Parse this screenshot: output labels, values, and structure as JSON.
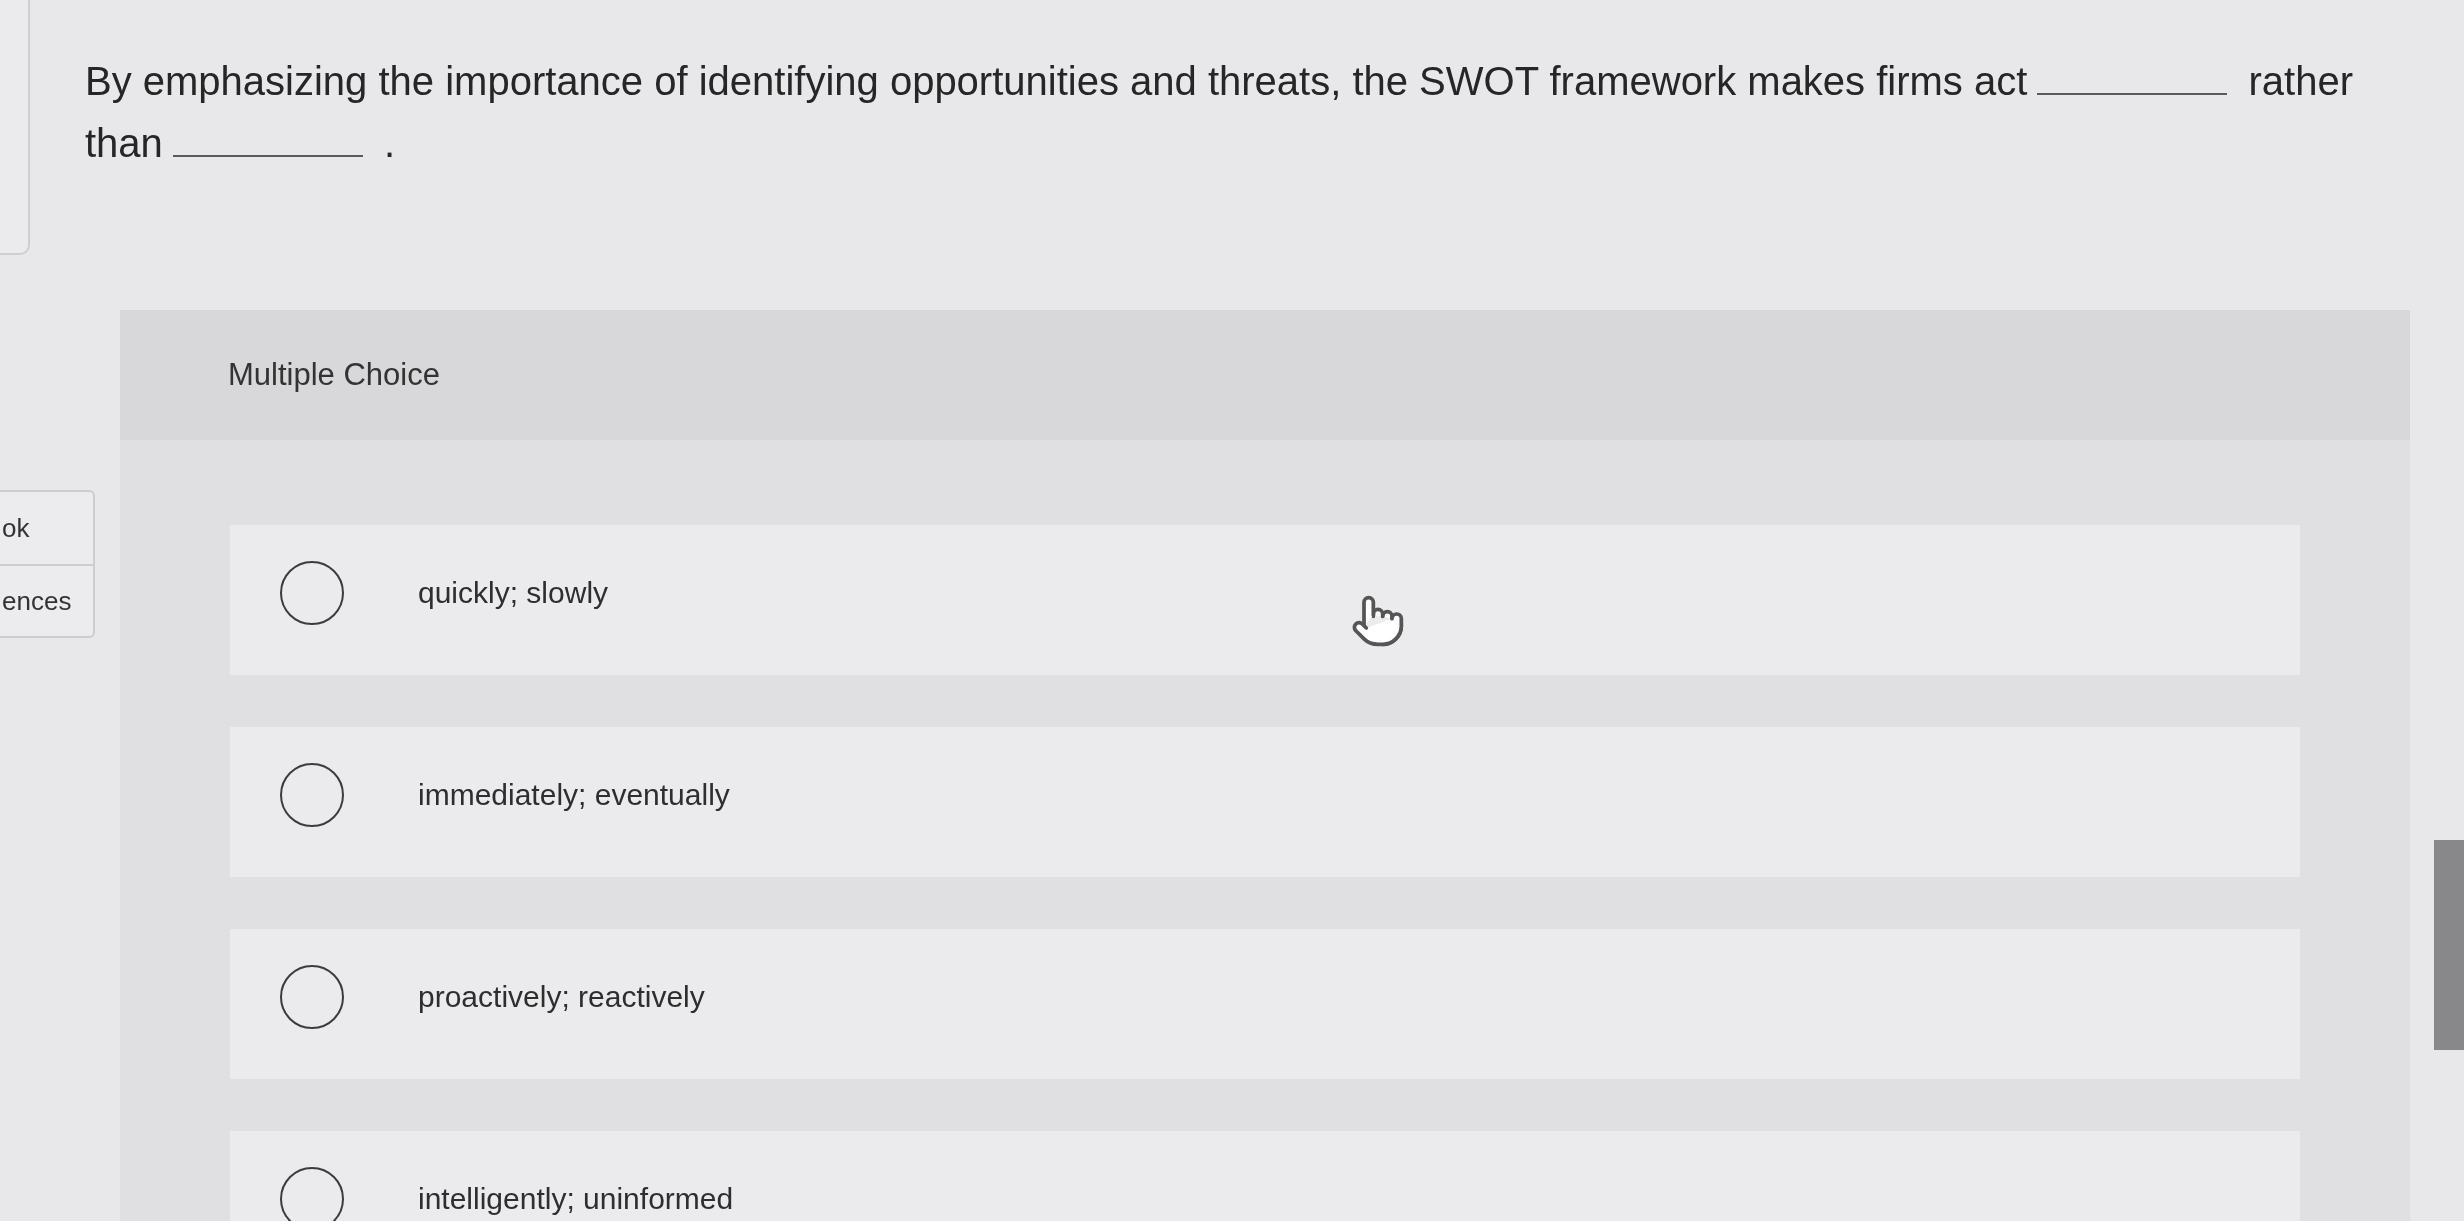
{
  "question": {
    "parts": [
      {
        "kind": "text",
        "text": "By emphasizing the importance of identifying opportunities and threats, the SWOT framework makes firms act"
      },
      {
        "kind": "blank"
      },
      {
        "kind": "text",
        "text": "rather than"
      },
      {
        "kind": "blank"
      },
      {
        "kind": "text",
        "text": "."
      }
    ]
  },
  "side_tabs": [
    {
      "label": "ok"
    },
    {
      "label": "ences"
    }
  ],
  "card": {
    "title": "Multiple Choice",
    "options": [
      {
        "label": "quickly; slowly",
        "selected": false
      },
      {
        "label": "immediately; eventually",
        "selected": false
      },
      {
        "label": "proactively; reactively",
        "selected": false
      },
      {
        "label": "intelligently; uninformed",
        "selected": false
      }
    ]
  }
}
